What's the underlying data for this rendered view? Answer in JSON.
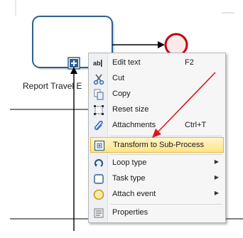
{
  "diagram": {
    "task_label": "Report Travel E"
  },
  "context_menu": {
    "items": [
      {
        "label": "Edit text",
        "shortcut": "F2",
        "icon": "edit-text-icon"
      },
      {
        "label": "Cut",
        "shortcut": "",
        "icon": "cut-icon"
      },
      {
        "label": "Copy",
        "shortcut": "",
        "icon": "copy-icon"
      },
      {
        "label": "Reset size",
        "shortcut": "",
        "icon": "reset-size-icon"
      },
      {
        "label": "Attachments",
        "shortcut": "Ctrl+T",
        "icon": "attachment-icon"
      },
      {
        "label": "Transform to Sub-Process",
        "shortcut": "",
        "icon": "subprocess-icon",
        "highlighted": true
      },
      {
        "label": "Loop type",
        "shortcut": "",
        "icon": "loop-icon",
        "submenu": true
      },
      {
        "label": "Task type",
        "shortcut": "",
        "icon": "task-type-icon",
        "submenu": true
      },
      {
        "label": "Attach event",
        "shortcut": "",
        "icon": "attach-event-icon",
        "submenu": true
      },
      {
        "label": "Properties",
        "shortcut": "",
        "icon": "properties-icon"
      }
    ]
  },
  "colors": {
    "task_border": "#2f5f8e",
    "end_event_stroke": "#c2000b",
    "end_event_fill": "#fde8ea",
    "highlight_bg": "#ffe48a",
    "annotation_arrow": "#e0141b"
  }
}
